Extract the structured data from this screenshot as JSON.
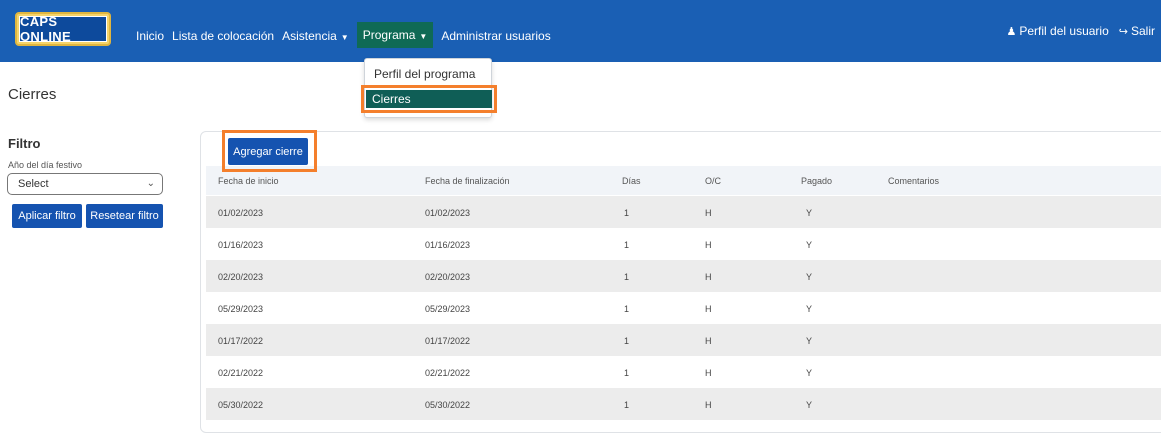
{
  "nav": {
    "logo": "CAPS ONLINE",
    "links": [
      "Inicio",
      "Lista de colocación",
      "Asistencia",
      "Programa",
      "Administrar usuarios"
    ],
    "profile": "Perfil del usuario",
    "logout": "Salir"
  },
  "dropdown": {
    "items": [
      "Perfil del programa",
      "Cierres"
    ]
  },
  "page": {
    "title": "Cierres"
  },
  "filter": {
    "title": "Filtro",
    "year_label": "Año del día festivo",
    "select_value": "Select",
    "apply": "Aplicar filtro",
    "reset": "Resetear filtro"
  },
  "table": {
    "add_button": "Agregar cierre",
    "headers": [
      "Fecha de inicio",
      "Fecha de finalización",
      "Días",
      "O/C",
      "Pagado",
      "Comentarios"
    ],
    "rows": [
      [
        "01/02/2023",
        "01/02/2023",
        "1",
        "H",
        "Y",
        ""
      ],
      [
        "01/16/2023",
        "01/16/2023",
        "1",
        "H",
        "Y",
        ""
      ],
      [
        "02/20/2023",
        "02/20/2023",
        "1",
        "H",
        "Y",
        ""
      ],
      [
        "05/29/2023",
        "05/29/2023",
        "1",
        "H",
        "Y",
        ""
      ],
      [
        "01/17/2022",
        "01/17/2022",
        "1",
        "H",
        "Y",
        ""
      ],
      [
        "02/21/2022",
        "02/21/2022",
        "1",
        "H",
        "Y",
        ""
      ],
      [
        "05/30/2022",
        "05/30/2022",
        "1",
        "H",
        "Y",
        ""
      ]
    ]
  },
  "colors": {
    "navbar": "#1a5fb4",
    "active": "#0f6a55",
    "highlight": "#f47f2c",
    "button": "#1553b0"
  }
}
